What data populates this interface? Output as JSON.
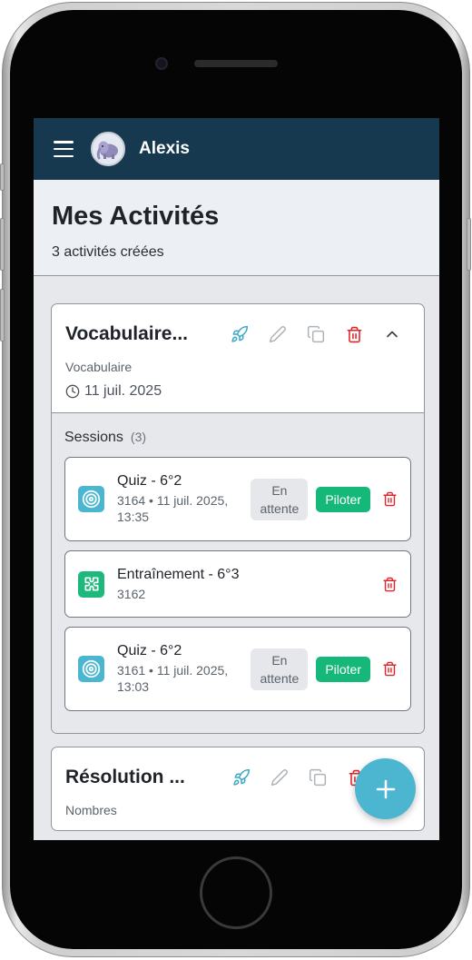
{
  "app_bar": {
    "user_name": "Alexis",
    "menu_icon": "hamburger-menu-icon",
    "avatar_icon": "elephant-avatar"
  },
  "page": {
    "title": "Mes Activités",
    "subtitle": "3 activités créées"
  },
  "activities": [
    {
      "title": "Vocabulaire...",
      "category": "Vocabulaire",
      "date": "11 juil. 2025",
      "expanded": true,
      "sessions_label": "Sessions",
      "sessions_count": "(3)",
      "sessions": [
        {
          "type": "quiz",
          "icon": "target-icon",
          "title": "Quiz - 6°2",
          "meta_line1": "3164 • 11 juil. 2025,",
          "meta_line2": "13:35",
          "status_line1": "En",
          "status_line2": "attente",
          "action_label": "Piloter"
        },
        {
          "type": "training",
          "icon": "puzzle-icon",
          "title": "Entraînement - 6°3",
          "meta_line1": "3162"
        },
        {
          "type": "quiz",
          "icon": "target-icon",
          "title": "Quiz - 6°2",
          "meta_line1": "3161 • 11 juil. 2025,",
          "meta_line2": "13:03",
          "status_line1": "En",
          "status_line2": "attente",
          "action_label": "Piloter"
        }
      ]
    },
    {
      "title": "Résolution ...",
      "category": "Nombres"
    }
  ],
  "colors": {
    "app_bar": "#17394f",
    "accent_teal": "#4ab6d0",
    "success_green": "#16b87a",
    "danger_red": "#e0262b"
  }
}
